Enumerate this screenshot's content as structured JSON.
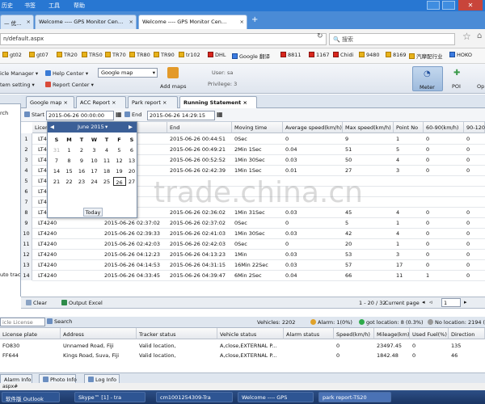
{
  "menubar": {
    "items": [
      "历史",
      "书签",
      "工具",
      "帮助"
    ]
  },
  "tabs": [
    {
      "label": "— 优…"
    },
    {
      "label": "Welcome ---- GPS Monitor Cen…"
    },
    {
      "label": "Welcome ---- GPS Monitor Cen…"
    }
  ],
  "address": {
    "url": "n/default.aspx",
    "search_placeholder": "搜索"
  },
  "bookmarks": [
    "gt02",
    "gt07",
    "TR20",
    "TR50",
    "TR70",
    "TR80",
    "TR90",
    "tr102",
    "DHL",
    "Google 翻译",
    "8811",
    "1167",
    "Chidi",
    "9480",
    "8169",
    "汽摩配行业",
    "HOKO"
  ],
  "toolbar": {
    "vehicle_manager": "icle Manager",
    "help_center": "Help Center",
    "system_setting": "tem setting",
    "report_center": "Report Center",
    "map_select": "Google map",
    "add_maps": "Add maps",
    "user": "User: sa",
    "privilege": "Privilege: 3",
    "meter": "Meter",
    "poi": "POI",
    "opt": "Op"
  },
  "leftpanel": {
    "search": "rch",
    "auto_track": "uto track"
  },
  "stmt_tabs": [
    "Google map",
    "ACC Report",
    "Park report",
    "Running Statement"
  ],
  "filter": {
    "start_label": "Start",
    "start_value": "2015-06-26 00:00:00",
    "end_label": "End",
    "end_value": "2015-06-26 14:29:15"
  },
  "grid": {
    "headers": [
      "Licen",
      "Start",
      "End",
      "Moving time",
      "Average speed(km/h)",
      "Max speed(km/h)",
      "Point No",
      "60-90(km/h)",
      "90-120("
    ],
    "rows": [
      {
        "n": "1",
        "lic": "LT4",
        "start": "04:51",
        "end": "2015-06-26 00:44:51",
        "move": "0Sec",
        "avg": "0",
        "max": "9",
        "pt": "1",
        "a": "0",
        "b": "0"
      },
      {
        "n": "2",
        "lic": "LT4",
        "start": "04:20",
        "end": "2015-06-26 00:49:21",
        "move": "2Min 1Sec",
        "avg": "0.04",
        "max": "51",
        "pt": "5",
        "a": "0",
        "b": "0"
      },
      {
        "n": "3",
        "lic": "LT4",
        "start": "02:22",
        "end": "2015-06-26 00:52:52",
        "move": "1Min 30Sec",
        "avg": "0.03",
        "max": "50",
        "pt": "4",
        "a": "0",
        "b": "0"
      },
      {
        "n": "4",
        "lic": "LT4",
        "start": "41:38",
        "end": "2015-06-26 02:42:39",
        "move": "1Min 1Sec",
        "avg": "0.01",
        "max": "27",
        "pt": "3",
        "a": "0",
        "b": "0"
      },
      {
        "n": "5",
        "lic": "LT4",
        "start": "",
        "end": "",
        "move": "",
        "avg": "",
        "max": "",
        "pt": "",
        "a": "",
        "b": ""
      },
      {
        "n": "6",
        "lic": "LT4",
        "start": "",
        "end": "",
        "move": "",
        "avg": "",
        "max": "",
        "pt": "",
        "a": "",
        "b": ""
      },
      {
        "n": "7",
        "lic": "LT4",
        "start": "",
        "end": "",
        "move": "",
        "avg": "",
        "max": "",
        "pt": "",
        "a": "",
        "b": ""
      },
      {
        "n": "8",
        "lic": "LT4",
        "start": "34:31",
        "end": "2015-06-26 02:36:02",
        "move": "1Min 31Sec",
        "avg": "0.03",
        "max": "45",
        "pt": "4",
        "a": "0",
        "b": "0"
      },
      {
        "n": "9",
        "lic": "LT4240",
        "start": "2015-06-26 02:37:02",
        "end": "2015-06-26 02:37:02",
        "move": "0Sec",
        "avg": "0",
        "max": "5",
        "pt": "1",
        "a": "0",
        "b": "0"
      },
      {
        "n": "10",
        "lic": "LT4240",
        "start": "2015-06-26 02:39:33",
        "end": "2015-06-26 02:41:03",
        "move": "1Min 30Sec",
        "avg": "0.03",
        "max": "42",
        "pt": "4",
        "a": "0",
        "b": "0"
      },
      {
        "n": "11",
        "lic": "LT4240",
        "start": "2015-06-26 02:42:03",
        "end": "2015-06-26 02:42:03",
        "move": "0Sec",
        "avg": "0",
        "max": "20",
        "pt": "1",
        "a": "0",
        "b": "0"
      },
      {
        "n": "12",
        "lic": "LT4240",
        "start": "2015-06-26 04:12:23",
        "end": "2015-06-26 04:13:23",
        "move": "1Min",
        "avg": "0.03",
        "max": "53",
        "pt": "3",
        "a": "0",
        "b": "0"
      },
      {
        "n": "13",
        "lic": "LT4240",
        "start": "2015-06-26 04:14:53",
        "end": "2015-06-26 04:31:15",
        "move": "16Min 22Sec",
        "avg": "0.03",
        "max": "57",
        "pt": "17",
        "a": "0",
        "b": "0"
      },
      {
        "n": "14",
        "lic": "LT4240",
        "start": "2015-06-26 04:33:45",
        "end": "2015-06-26 04:39:47",
        "move": "6Min 2Sec",
        "avg": "0.04",
        "max": "66",
        "pt": "11",
        "a": "1",
        "b": "0"
      }
    ]
  },
  "calendar": {
    "month": "June 2015",
    "weekdays": [
      "S",
      "M",
      "T",
      "W",
      "T",
      "F",
      "S"
    ],
    "days": [
      [
        "31",
        "1",
        "2",
        "3",
        "4",
        "5",
        "6"
      ],
      [
        "7",
        "8",
        "9",
        "10",
        "11",
        "12",
        "13"
      ],
      [
        "14",
        "15",
        "16",
        "17",
        "18",
        "19",
        "20"
      ],
      [
        "21",
        "22",
        "23",
        "24",
        "25",
        "26",
        "27"
      ]
    ],
    "today": "Today"
  },
  "gridfoot": {
    "clear": "Clear",
    "output": "Output Excel",
    "range": "1 - 20 / 32",
    "current_page": "Current page",
    "page": "1"
  },
  "vehbar": {
    "license": "icle License",
    "search": "Search",
    "vehicles": "Vehicles: 2202",
    "alarm": "Alarm: 1(0%)",
    "got_location": "got location: 8 (0.3%)",
    "no_location": "No location: 2194 (99"
  },
  "vtable": {
    "headers": [
      "License plate",
      "Address",
      "Tracker status",
      "Vehicle status",
      "Alarm status",
      "Speed(km/h)",
      "Mileage(km)",
      "Used Fuel(%)",
      "Direction"
    ],
    "rows": [
      {
        "plate": "FO830",
        "addr": "Unnamed Road, Fiji",
        "tracker": "Valid location,",
        "vstatus": "A,close,EXTERNAL P...",
        "alarm": "",
        "speed": "0",
        "mileage": "23497.45",
        "fuel": "0",
        "dir": "135"
      },
      {
        "plate": "FF644",
        "addr": "Kings Road, Suva, Fiji",
        "tracker": "Valid location,",
        "vstatus": "A,close,EXTERNAL P...",
        "alarm": "",
        "speed": "0",
        "mileage": "1842.48",
        "fuel": "0",
        "dir": "46"
      }
    ]
  },
  "bottom_tabs": [
    "Alarm Info",
    "Photo Info",
    "Log Info"
  ],
  "status_line": "aspx#",
  "taskbar": [
    "软件版",
    "Outlook",
    "Skype™ [1] - tra",
    "cm1001254309-Tra",
    "Welcome ---- GPS",
    "park report-TS20"
  ],
  "watermark": "trade.china.cn",
  "colors": {
    "accent": "#2877d2",
    "header": "#3b5f97",
    "selected": "#c3d7ee"
  }
}
